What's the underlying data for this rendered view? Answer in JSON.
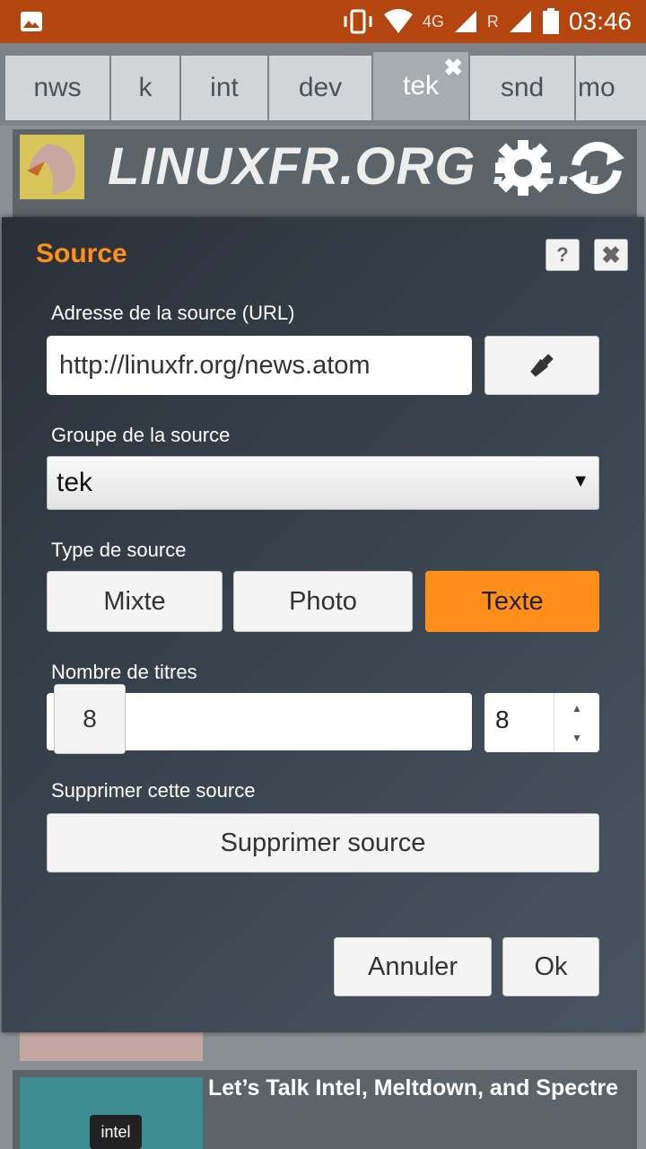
{
  "status_bar": {
    "network": "4G",
    "roaming": "R",
    "time": "03:46",
    "icons": [
      "gallery-icon",
      "vibrate-icon",
      "wifi-icon",
      "signal-icon",
      "battery-icon"
    ]
  },
  "tabs": [
    {
      "label": "nws"
    },
    {
      "label": "k"
    },
    {
      "label": "int"
    },
    {
      "label": "dev"
    },
    {
      "label": "tek",
      "active": true,
      "close_glyph": "✖"
    },
    {
      "label": "snd"
    },
    {
      "label": "mo"
    }
  ],
  "background": {
    "feed_title": "LINUXFR.ORG : L...",
    "article_title": "Let’s Talk Intel, Meltdown, and Spectre",
    "intel_badge": "intel"
  },
  "dialog": {
    "title": "Source",
    "help_glyph": "?",
    "close_glyph": "✖",
    "url_label": "Adresse de la source (URL)",
    "url_value": "http://linuxfr.org/news.atom",
    "group_label": "Groupe de la source",
    "group_value": "tek",
    "group_arrow": "▼",
    "type_label": "Type de source",
    "types": [
      {
        "label": "Mixte",
        "active": false
      },
      {
        "label": "Photo",
        "active": false
      },
      {
        "label": "Texte",
        "active": true
      }
    ],
    "count_label": "Nombre de titres",
    "count_slider_value": "8",
    "count_number_value": "8",
    "spin_up": "▲",
    "spin_down": "▼",
    "delete_label": "Supprimer cette source",
    "delete_button": "Supprimer source",
    "cancel_button": "Annuler",
    "ok_button": "Ok"
  },
  "colors": {
    "status_bar": "#b5450f",
    "accent": "#ff8f1a",
    "dialog_bg": "#3c4650"
  }
}
